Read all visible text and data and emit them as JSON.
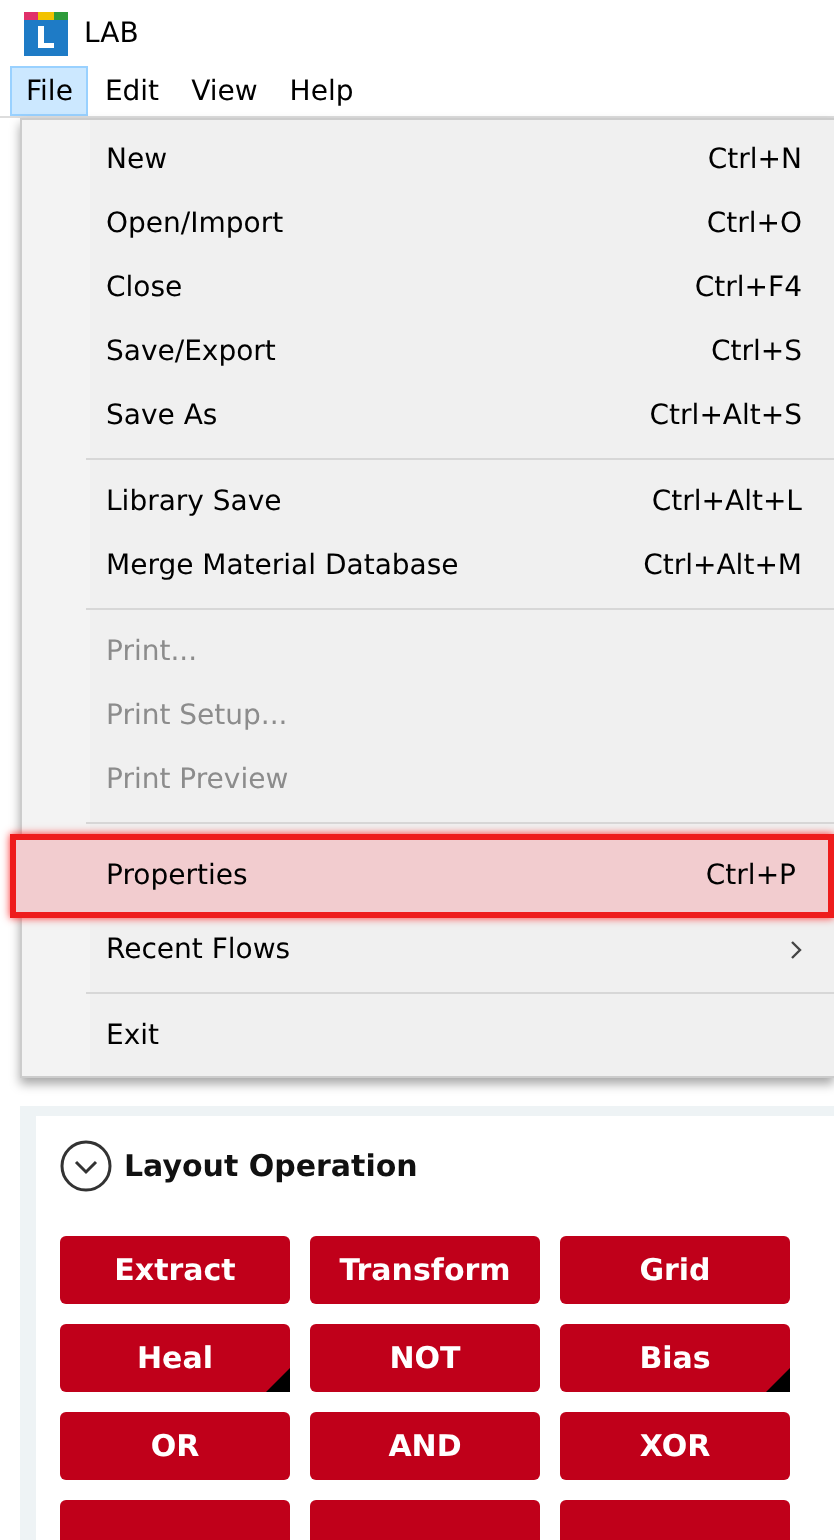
{
  "window": {
    "title": "LAB"
  },
  "menubar": [
    {
      "label": "File",
      "selected": true
    },
    {
      "label": "Edit",
      "selected": false
    },
    {
      "label": "View",
      "selected": false
    },
    {
      "label": "Help",
      "selected": false
    }
  ],
  "menu": [
    {
      "kind": "item",
      "label": "New",
      "shortcut": "Ctrl+N",
      "disabled": false,
      "selected": false
    },
    {
      "kind": "item",
      "label": "Open/Import",
      "shortcut": "Ctrl+O",
      "disabled": false,
      "selected": false
    },
    {
      "kind": "item",
      "label": "Close",
      "shortcut": "Ctrl+F4",
      "disabled": false,
      "selected": false
    },
    {
      "kind": "item",
      "label": "Save/Export",
      "shortcut": "Ctrl+S",
      "disabled": false,
      "selected": false
    },
    {
      "kind": "item",
      "label": "Save As",
      "shortcut": "Ctrl+Alt+S",
      "disabled": false,
      "selected": false
    },
    {
      "kind": "separator"
    },
    {
      "kind": "item",
      "label": "Library Save",
      "shortcut": "Ctrl+Alt+L",
      "disabled": false,
      "selected": false
    },
    {
      "kind": "item",
      "label": "Merge Material Database",
      "shortcut": "Ctrl+Alt+M",
      "disabled": false,
      "selected": false
    },
    {
      "kind": "separator"
    },
    {
      "kind": "item",
      "label": "Print...",
      "disabled": true,
      "selected": false
    },
    {
      "kind": "item",
      "label": "Print Setup...",
      "disabled": true,
      "selected": false
    },
    {
      "kind": "item",
      "label": "Print Preview",
      "disabled": true,
      "selected": false
    },
    {
      "kind": "separator"
    },
    {
      "kind": "item",
      "label": "Properties",
      "shortcut": "Ctrl+P",
      "disabled": false,
      "selected": true
    },
    {
      "kind": "submenu",
      "label": "Recent Flows",
      "disabled": false,
      "selected": false
    },
    {
      "kind": "separator"
    },
    {
      "kind": "item",
      "label": "Exit",
      "disabled": false,
      "selected": false
    }
  ],
  "panel": {
    "title": "Layout Operation",
    "expanded": true,
    "buttons": [
      {
        "label": "Extract",
        "has_dropdown": false
      },
      {
        "label": "Transform",
        "has_dropdown": false
      },
      {
        "label": "Grid",
        "has_dropdown": false
      },
      {
        "label": "Heal",
        "has_dropdown": true
      },
      {
        "label": "NOT",
        "has_dropdown": false
      },
      {
        "label": "Bias",
        "has_dropdown": true
      },
      {
        "label": "OR",
        "has_dropdown": false
      },
      {
        "label": "AND",
        "has_dropdown": false
      },
      {
        "label": "XOR",
        "has_dropdown": false
      }
    ]
  }
}
